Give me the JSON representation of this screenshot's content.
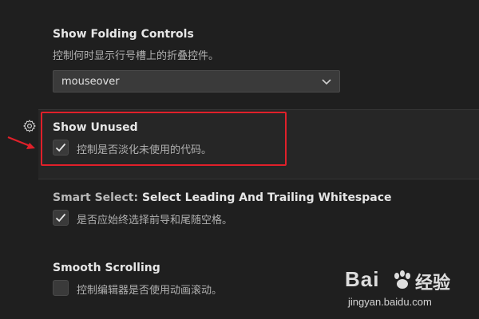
{
  "settings": [
    {
      "title": "Show Folding Controls",
      "description": "控制何时显示行号槽上的折叠控件。",
      "dropdown_value": "mouseover"
    },
    {
      "title": "Show Unused",
      "description": "控制是否淡化未使用的代码。",
      "checked": true
    },
    {
      "title_prefix": "Smart Select: ",
      "title": "Select Leading And Trailing Whitespace",
      "description": "是否应始终选择前导和尾随空格。",
      "checked": true
    },
    {
      "title": "Smooth Scrolling",
      "description": "控制编辑器是否使用动画滚动。",
      "checked": false
    }
  ],
  "icons": {
    "settings_gear": "gear-icon",
    "dropdown_chevron": "chevron-down-icon",
    "checkmark": "checkmark-icon"
  },
  "annotation": {
    "highlight_color": "#e0202a"
  },
  "watermark": {
    "brand": "Bai",
    "brand_suffix": "经验",
    "url": "jingyan.baidu.com"
  }
}
